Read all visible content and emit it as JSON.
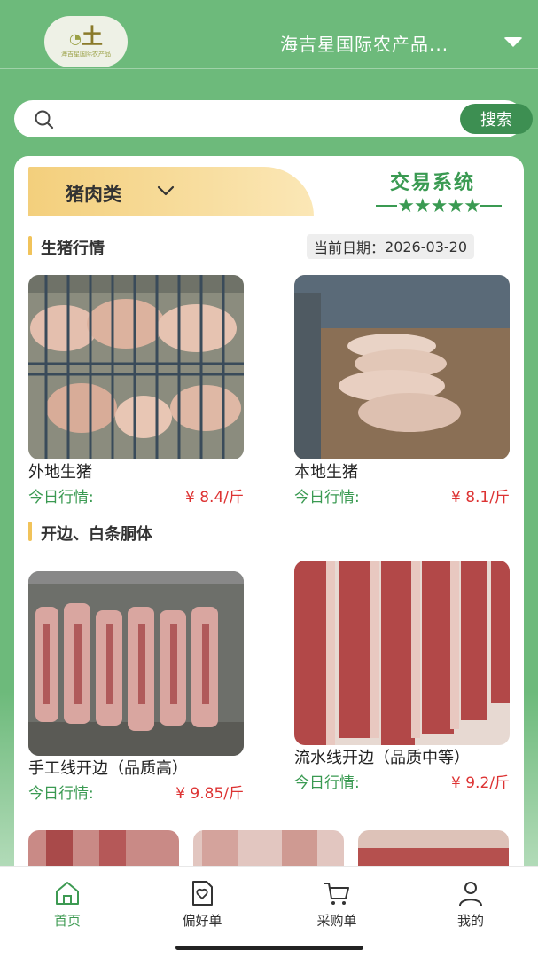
{
  "header": {
    "logo_text": "土",
    "logo_sub": "海吉星国际农产品",
    "company_name": "海吉星国际农产品..."
  },
  "search": {
    "placeholder": "",
    "button_label": "搜索"
  },
  "category": {
    "selected": "猪肉类"
  },
  "brand": {
    "title": "交易系统",
    "stars": "★★★★★"
  },
  "sections": [
    {
      "title": "生猪行情",
      "date_label": "当前日期：",
      "date_value": "2026-03-20",
      "products": [
        {
          "name": "外地生猪",
          "price_label": "今日行情:",
          "price": "¥ 8.4/斤"
        },
        {
          "name": "本地生猪",
          "price_label": "今日行情:",
          "price": "¥ 8.1/斤"
        }
      ]
    },
    {
      "title": "开边、白条胴体",
      "products": [
        {
          "name": "手工线开边（品质高）",
          "price_label": "今日行情:",
          "price": "¥ 9.85/斤"
        },
        {
          "name": "流水线开边（品质中等）",
          "price_label": "今日行情:",
          "price": "¥ 9.2/斤"
        }
      ]
    }
  ],
  "nav": [
    {
      "label": "首页",
      "icon": "home-icon",
      "active": true
    },
    {
      "label": "偏好单",
      "icon": "favorites-icon",
      "active": false
    },
    {
      "label": "采购单",
      "icon": "cart-icon",
      "active": false
    },
    {
      "label": "我的",
      "icon": "user-icon",
      "active": false
    }
  ],
  "colors": {
    "brand_green": "#6dba7b",
    "accent_green": "#3d8f52",
    "price_red": "#d33333",
    "tab_gold": "#f3cf7c"
  }
}
